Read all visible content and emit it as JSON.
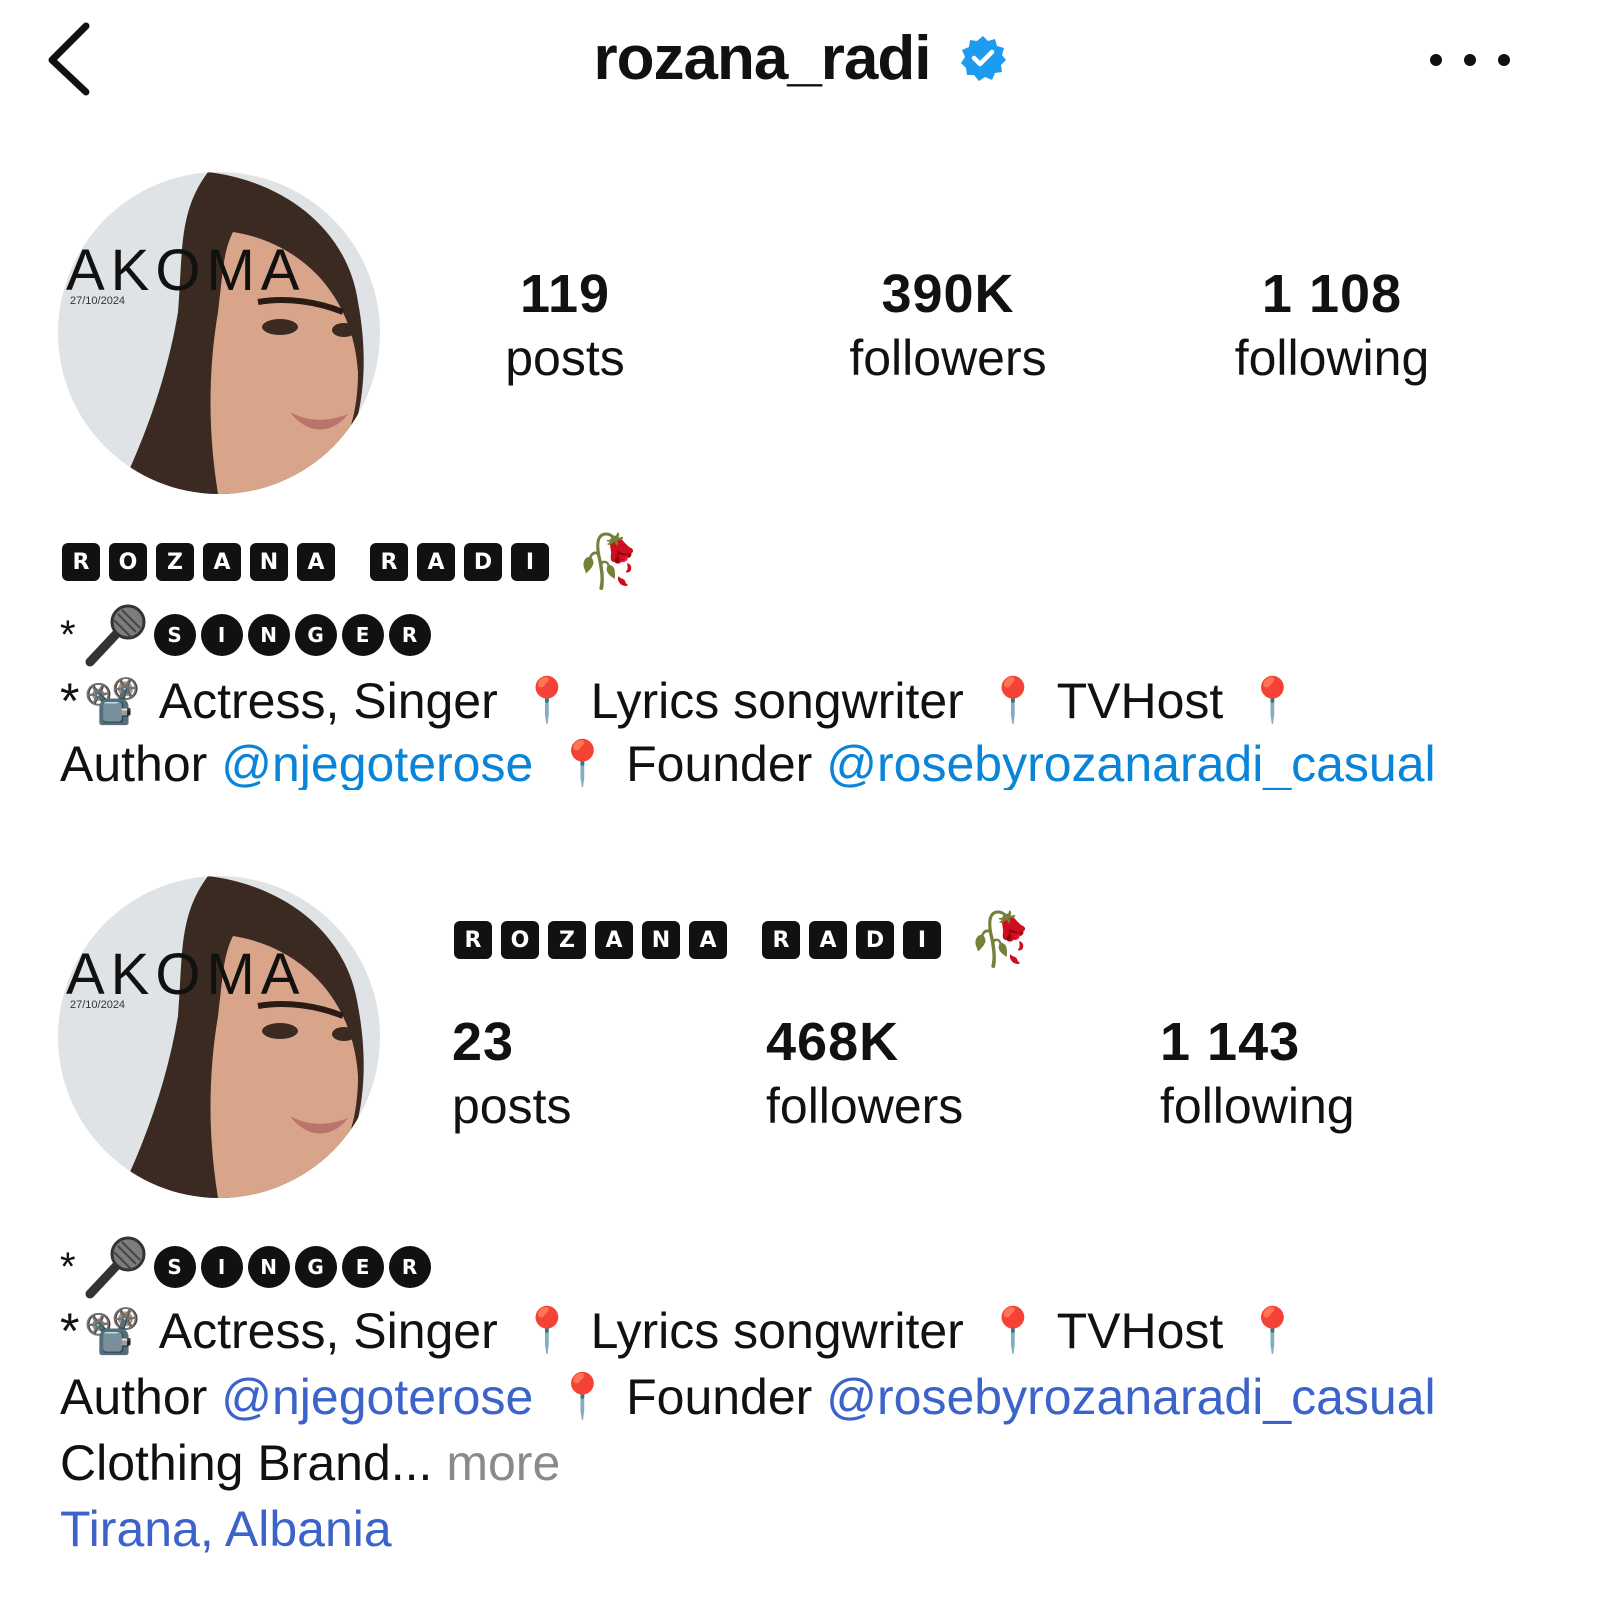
{
  "header": {
    "username": "rozana_radi",
    "back_icon": "chevron-left-icon",
    "more_icon": "ellipsis-icon",
    "verified_icon": "verified-badge-icon",
    "verified_color": "#1d9bf0"
  },
  "avatar": {
    "poster_text": "AKOMA",
    "poster_date": "27/10/2024"
  },
  "profile_top": {
    "stats": {
      "posts": "119",
      "posts_label": "posts",
      "followers": "390K",
      "followers_label": "followers",
      "following": "1 108",
      "following_label": "following"
    }
  },
  "profile_bottom": {
    "stats": {
      "posts": "23",
      "posts_label": "posts",
      "followers": "468K",
      "followers_label": "followers",
      "following": "1 143",
      "following_label": "following"
    }
  },
  "display_name_letters": [
    "R",
    "O",
    "Z",
    "A",
    "N",
    "A",
    " ",
    "R",
    "A",
    "D",
    "I"
  ],
  "rose_emoji": "🥀",
  "singer": {
    "star": "*",
    "letters": [
      "S",
      "I",
      "N",
      "G",
      "E",
      "R"
    ],
    "mic_icon": "microphone-icon"
  },
  "bio": {
    "line1_prefix": "*",
    "projector_emoji": "📽️",
    "roles": "Actress, Singer",
    "pin_emoji": "📍",
    "lyrics": "Lyrics songwriter",
    "tvhost": "TVHost",
    "author": "Author",
    "author_link": "@njegoterose",
    "founder": "Founder",
    "founder_link": "@rosebyrozanaradi_casual",
    "clothing": "Clothing Brand...",
    "more": "more",
    "location": "Tirana, Albania"
  },
  "colors": {
    "link": "#3b63c9",
    "text": "#111111",
    "muted": "#8a8a8a"
  }
}
